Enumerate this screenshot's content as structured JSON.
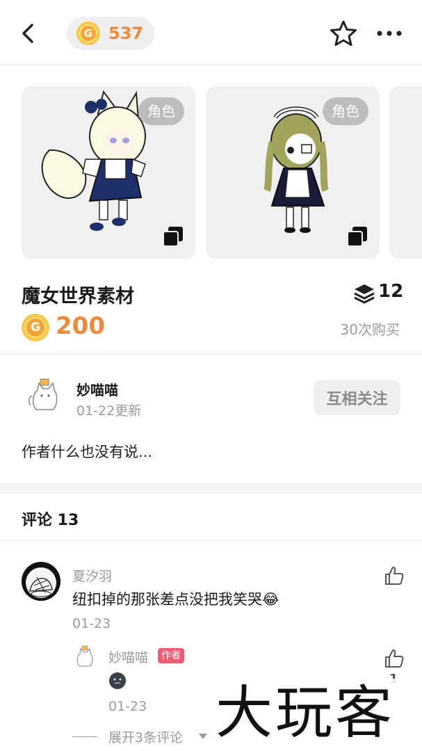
{
  "header": {
    "coin_balance": "537",
    "coin_symbol": "G"
  },
  "cards": [
    {
      "tag": "角色",
      "character": "fox-girl-sprite"
    },
    {
      "tag": "角色",
      "character": "maid-girl-sprite"
    }
  ],
  "product": {
    "title": "魔女世界素材",
    "item_count": "12",
    "price": "200",
    "purchases": "30次购买"
  },
  "author": {
    "name": "妙喵喵",
    "updated": "01-22更新",
    "follow_label": "互相关注",
    "description": "作者什么也没有说..."
  },
  "comments": {
    "title": "评论 13",
    "items": [
      {
        "user": "夏汐羽",
        "text": "纽扣掉的那张差点没把我笑哭😂",
        "date": "01-23",
        "reply": {
          "user": "妙喵喵",
          "badge": "作者",
          "date": "01-23",
          "likes": "1"
        },
        "expand_label": "展开3条评论"
      }
    ]
  },
  "watermark": "大玩客",
  "colors": {
    "accent": "#f08a3a",
    "badge": "#f05d72",
    "muted": "#9a9a9a"
  }
}
